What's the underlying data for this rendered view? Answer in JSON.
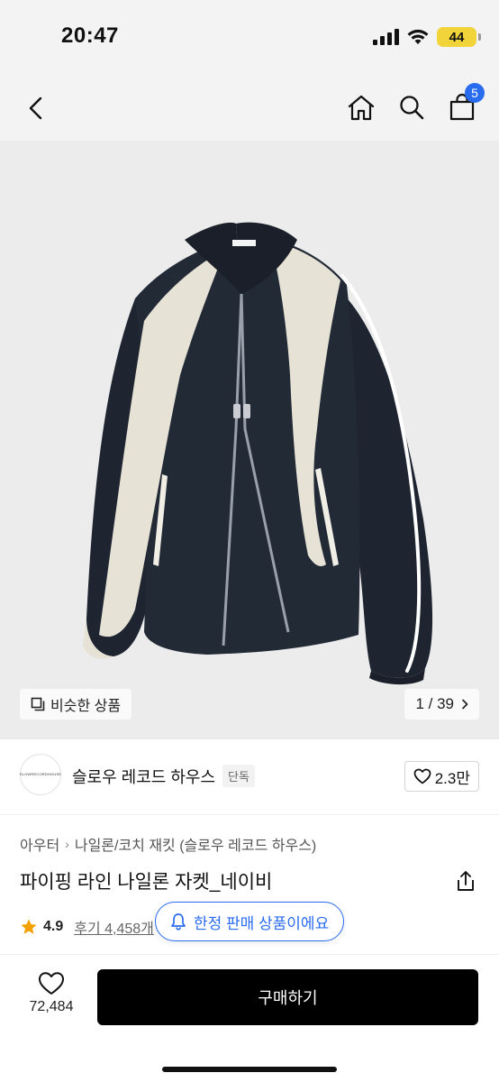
{
  "status_bar": {
    "time": "20:47",
    "battery": "44"
  },
  "nav": {
    "cart_count": "5"
  },
  "gallery": {
    "similar_label": "비슷한 상품",
    "page_counter": "1 / 39"
  },
  "brand": {
    "logo_text": "SLOWRECORDHOUSE",
    "name": "슬로우 레코드 하우스",
    "tag": "단독",
    "likes": "2.3만"
  },
  "breadcrumb": {
    "root": "아우터",
    "category": "나일론/코치 재킷 (슬로우 레코드 하우스)"
  },
  "product": {
    "title": "파이핑 라인 나일론 자켓_네이비",
    "rating": "4.9",
    "reviews": "후기 4,458개"
  },
  "toast": {
    "message": "한정 판매 상품이에요"
  },
  "bottom_bar": {
    "wish_count": "72,484",
    "buy_label": "구매하기"
  },
  "colors": {
    "accent": "#2a6cf0",
    "jacket_navy": "#1e2430",
    "jacket_panel": "#e7e2d6",
    "star": "#f4a100",
    "buy_button": "#000000"
  }
}
